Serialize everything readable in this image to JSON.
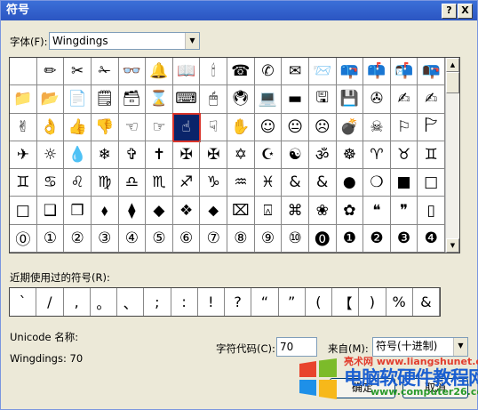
{
  "window": {
    "title": "符号",
    "help_btn": "?",
    "close_btn": "X"
  },
  "font": {
    "label": "字体(F):",
    "value": "Wingdings"
  },
  "grid_glyphs": [
    "",
    "✏",
    "✂",
    "✁",
    "👓",
    "🔔",
    "📖",
    "🕯",
    "☎",
    "✆",
    "✉",
    "📨",
    "📪",
    "📫",
    "📬",
    "📭",
    "📁",
    "📂",
    "📄",
    "🗒",
    "🗃",
    "⌛",
    "⌨",
    "🖱",
    "🖲",
    "💻",
    "▬",
    "🖫",
    "💾",
    "✇",
    "✍",
    "✍",
    "✌",
    "👌",
    "👍",
    "👎",
    "☜",
    "☞",
    "☝",
    "☟",
    "✋",
    "☺",
    "😐",
    "☹",
    "💣",
    "☠",
    "⚐",
    "🏱",
    "✈",
    "☼",
    "💧",
    "❄",
    "✞",
    "✝",
    "✠",
    "✠",
    "✡",
    "☪",
    "☯",
    "ॐ",
    "☸",
    "♈",
    "♉",
    "♊",
    "♊",
    "♋",
    "♌",
    "♍",
    "♎",
    "♏",
    "♐",
    "♑",
    "♒",
    "♓",
    "&",
    "&",
    "●",
    "❍",
    "■",
    "□",
    "□",
    "❑",
    "❒",
    "⬧",
    "⧫",
    "◆",
    "❖",
    "⬥",
    "⌧",
    "⍓",
    "⌘",
    "❀",
    "✿",
    "❝",
    "❞",
    "▯",
    "⓪",
    "①",
    "②",
    "③",
    "④",
    "⑤",
    "⑥",
    "⑦",
    "⑧",
    "⑨",
    "⑩",
    "⓿",
    "❶",
    "❷",
    "❸",
    "❹"
  ],
  "selected_index": 38,
  "recent": {
    "label": "近期使用过的符号(R):",
    "symbols": [
      "`",
      "/",
      ",",
      "。",
      "、",
      ";",
      ":",
      "!",
      "?",
      "“",
      "”",
      "(",
      "【",
      ")",
      "%",
      "&"
    ]
  },
  "unicode_label": "Unicode 名称:",
  "char_name": "Wingdings: 70",
  "char_code": {
    "label": "字符代码(C):",
    "value": "70"
  },
  "from": {
    "label": "来自(M):",
    "value": "符号(十进制)"
  },
  "buttons": {
    "ok": "确定",
    "cancel": "取消"
  },
  "watermark": {
    "top": "亮术网",
    "url": "www.liangshunet.com",
    "brand": "电脑软硬件教程网",
    "url2": "www.computer26.com"
  }
}
